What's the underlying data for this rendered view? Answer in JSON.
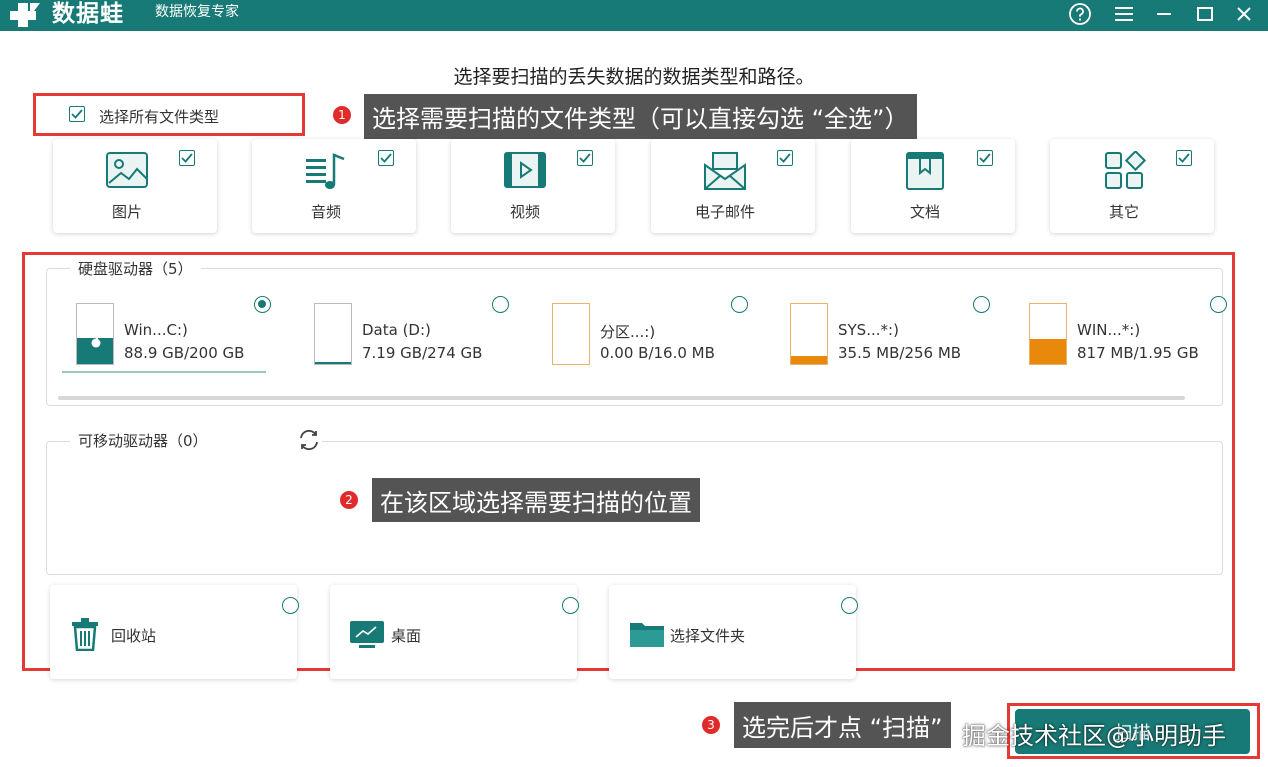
{
  "app": {
    "brand": "数据蛙",
    "subtitle": "数据恢复专家"
  },
  "window_controls": [
    "help-icon",
    "menu-icon",
    "minimize-icon",
    "maximize-icon",
    "close-icon"
  ],
  "heading": "选择要扫描的丢失数据的数据类型和路径。",
  "select_all": {
    "label": "选择所有文件类型",
    "checked": true
  },
  "callouts": [
    {
      "num": "1",
      "text": "选择需要扫描的文件类型（可以直接勾选 “全选”）"
    },
    {
      "num": "2",
      "text": "在该区域选择需要扫描的位置"
    },
    {
      "num": "3",
      "text": "选完后才点 “扫描”"
    }
  ],
  "file_types": [
    {
      "label": "图片",
      "icon": "image-icon",
      "checked": true
    },
    {
      "label": "音频",
      "icon": "audio-icon",
      "checked": true
    },
    {
      "label": "视频",
      "icon": "video-icon",
      "checked": true
    },
    {
      "label": "电子邮件",
      "icon": "email-icon",
      "checked": true
    },
    {
      "label": "文档",
      "icon": "document-icon",
      "checked": true
    },
    {
      "label": "其它",
      "icon": "other-icon",
      "checked": true
    }
  ],
  "hard_drives": {
    "title": "硬盘驱动器（5）",
    "items": [
      {
        "name": "Win...C:)",
        "size": "88.9 GB/200 GB",
        "selected": true,
        "fill": 0.44,
        "color": "#177a76",
        "icon": "windows-drive-icon"
      },
      {
        "name": "Data (D:)",
        "size": "7.19 GB/274 GB",
        "selected": false,
        "fill": 0.03,
        "color": "#177a76",
        "icon": "drive-icon"
      },
      {
        "name": "分区...:)",
        "size": "0.00  B/16.0 MB",
        "selected": false,
        "fill": 0,
        "color": "#e8890c",
        "icon": "drive-icon"
      },
      {
        "name": "SYS...*:)",
        "size": "35.5 MB/256 MB",
        "selected": false,
        "fill": 0.14,
        "color": "#e8890c",
        "icon": "drive-icon"
      },
      {
        "name": "WIN...*:)",
        "size": "817 MB/1.95 GB",
        "selected": false,
        "fill": 0.41,
        "color": "#e8890c",
        "icon": "drive-icon"
      }
    ]
  },
  "removable": {
    "title": "可移动驱动器（0）",
    "refresh_icon": "refresh-icon"
  },
  "locations": [
    {
      "label": "回收站",
      "icon": "recycle-bin-icon"
    },
    {
      "label": "桌面",
      "icon": "desktop-icon"
    },
    {
      "label": "选择文件夹",
      "icon": "folder-icon"
    }
  ],
  "scan_button": {
    "label": "扫描"
  },
  "watermark": "掘金技术社区@小明助手",
  "colors": {
    "primary": "#177a76",
    "highlight": "#e53935",
    "callout_bg": "#545454",
    "drive_warn": "#e8890c"
  }
}
